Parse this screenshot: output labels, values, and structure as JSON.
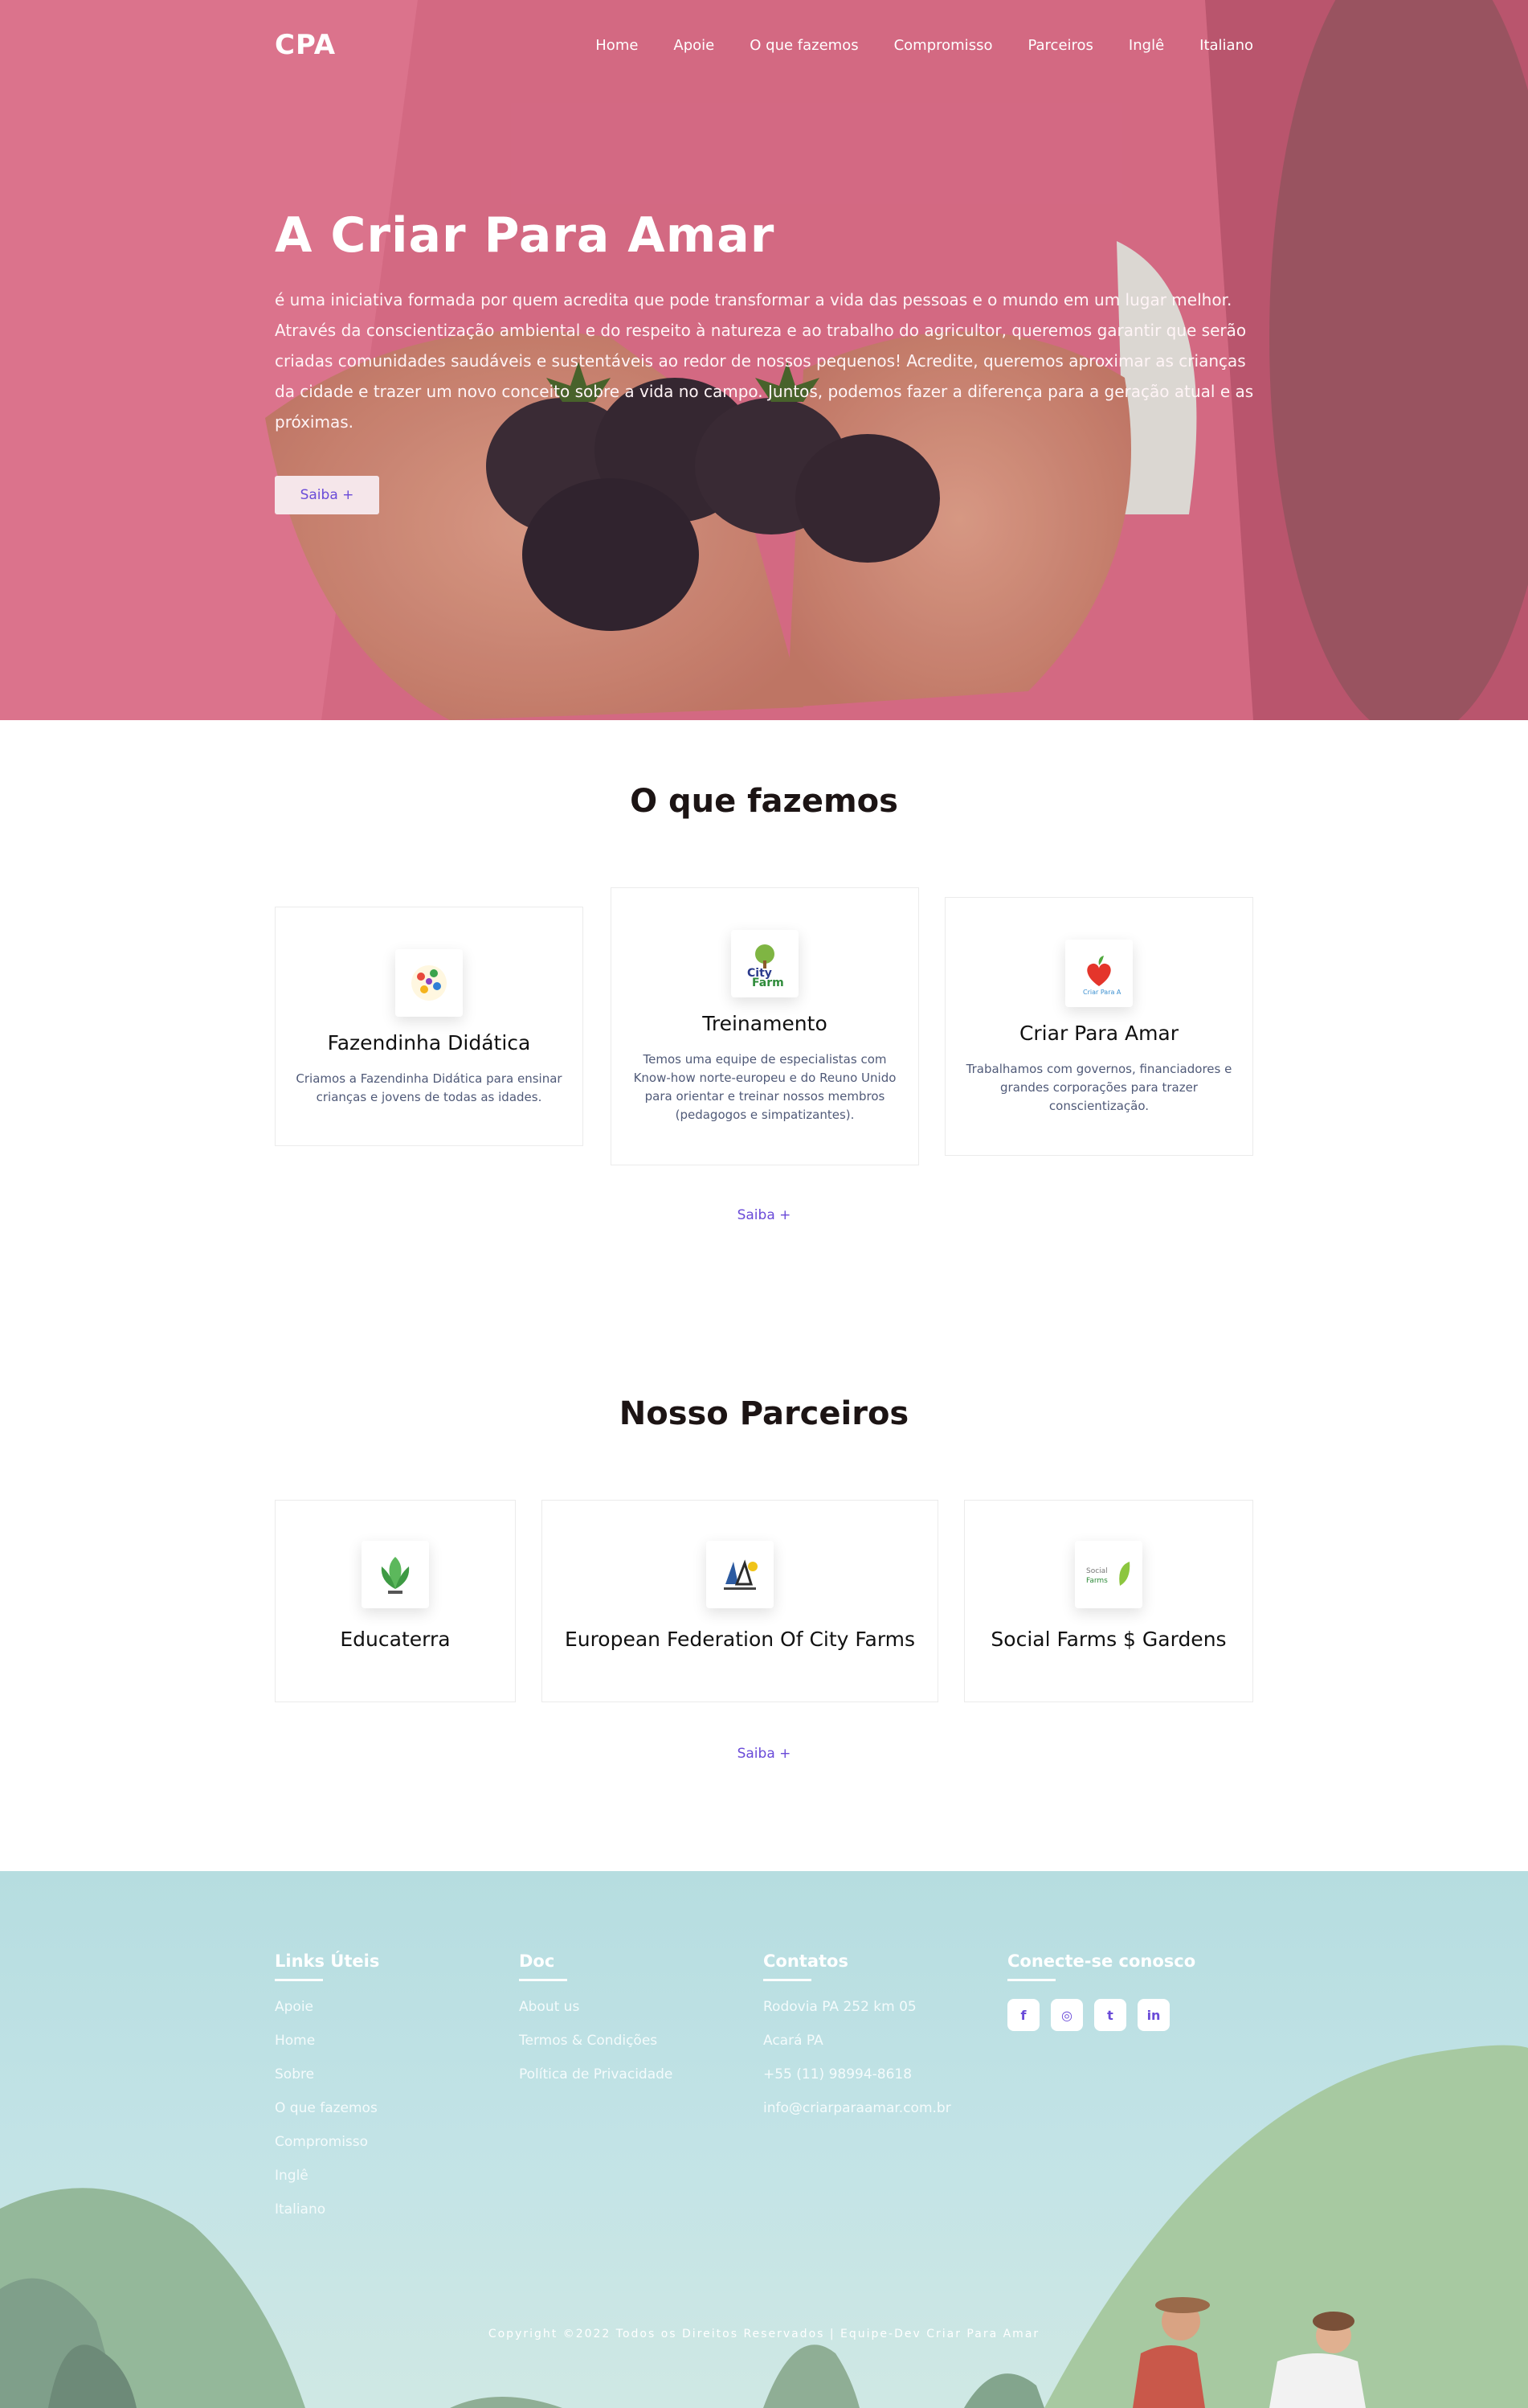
{
  "nav": {
    "logo": "CPA",
    "items": [
      "Home",
      "Apoie",
      "O que fazemos",
      "Compromisso",
      "Parceiros",
      "Inglê",
      "Italiano"
    ]
  },
  "hero": {
    "title": "A Criar Para Amar",
    "text": "é uma iniciativa formada por quem acredita que pode transformar a vida das pessoas e o mundo em um lugar melhor. Através da conscientização ambiental e do respeito à natureza e ao trabalho do agricultor, queremos garantir que serão criadas comunidades saudáveis e sustentáveis ao redor de nossos pequenos! Acredite, queremos aproximar as crianças da cidade e trazer um novo conceito sobre a vida no campo. Juntos, podemos fazer a diferença para a geração atual e as próximas.",
    "button": "Saiba +"
  },
  "what_we_do": {
    "title": "O que fazemos",
    "cards": [
      {
        "icon": "fazendinha-logo-icon",
        "title": "Fazendinha Didática",
        "text": "Criamos a Fazendinha Didática para ensinar crianças e jovens de todas as idades."
      },
      {
        "icon": "city-farm-logo-icon",
        "title": "Treinamento",
        "text": "Temos uma equipe de especialistas com Know-how norte-europeu e do Reuno Unido para orientar e treinar nossos membros (pedagogos e simpatizantes)."
      },
      {
        "icon": "heart-plant-logo-icon",
        "title": "Criar Para Amar",
        "text": "Trabalhamos com governos, financiadores e grandes corporações para trazer conscientização."
      }
    ],
    "more": "Saiba +"
  },
  "partners": {
    "title": "Nosso Parceiros",
    "cards": [
      {
        "icon": "educaterra-logo-icon",
        "title": "Educaterra"
      },
      {
        "icon": "city-farms-federation-logo-icon",
        "title": "European Federation Of City Farms"
      },
      {
        "icon": "social-farms-logo-icon",
        "title": "Social Farms $ Gardens"
      }
    ],
    "more": "Saiba +"
  },
  "footer": {
    "links_title": "Links Úteis",
    "links": [
      "Apoie",
      "Home",
      "Sobre",
      "O que fazemos",
      "Compromisso",
      "Inglê",
      "Italiano"
    ],
    "doc_title": "Doc",
    "docs": [
      "About us",
      "Termos & Condições",
      "Política de Privacidade"
    ],
    "contacts_title": "Contatos",
    "contacts": [
      "Rodovia PA 252 km 05",
      "Acará PA",
      "+55 (11) 98994-8618",
      "info@criarparaamar.com.br"
    ],
    "connect_title": "Conecte-se conosco",
    "socials": [
      {
        "icon": "facebook-icon",
        "glyph": "f"
      },
      {
        "icon": "instagram-icon",
        "glyph": "◎"
      },
      {
        "icon": "twitter-icon",
        "glyph": "t"
      },
      {
        "icon": "linkedin-icon",
        "glyph": "in"
      }
    ],
    "copyright": "Copyright ©2022 Todos os Direitos Reservados | Equipe-Dev Criar Para Amar"
  },
  "colors": {
    "accent": "#6a4bd8",
    "hero_pink": "#e86f8c",
    "footer_teal": "#b6dde0"
  }
}
